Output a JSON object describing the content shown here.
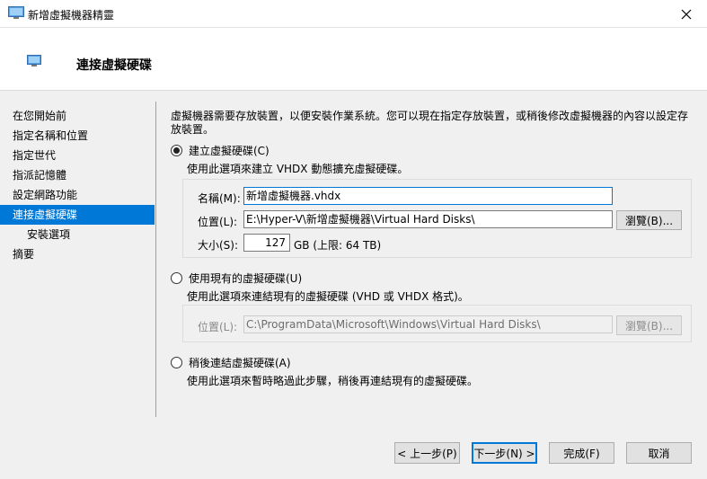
{
  "window": {
    "title": "新增虛擬機器精靈"
  },
  "header": {
    "title": "連接虛擬硬碟"
  },
  "nav": {
    "items": [
      {
        "label": "在您開始前"
      },
      {
        "label": "指定名稱和位置"
      },
      {
        "label": "指定世代"
      },
      {
        "label": "指派記憶體"
      },
      {
        "label": "設定網路功能"
      },
      {
        "label": "連接虛擬硬碟"
      },
      {
        "label": "安裝選項"
      },
      {
        "label": "摘要"
      }
    ],
    "active_index": 5
  },
  "main": {
    "intro_line1": "虛擬機器需要存放裝置，以便安裝作業系統。您可以現在指定存放裝置，或稍後修改虛擬機器的內容以設定存",
    "intro_line2": "放裝置。",
    "create": {
      "label": "建立虛擬硬碟(C)",
      "description": "使用此選項來建立 VHDX 動態擴充虛擬硬碟。",
      "name_label": "名稱(M):",
      "name_value": "新增虛擬機器.vhdx",
      "location_label": "位置(L):",
      "location_value": "E:\\Hyper-V\\新增虛擬機器\\Virtual Hard Disks\\",
      "browse_label": "瀏覽(B)...",
      "size_label": "大小(S):",
      "size_value": "127",
      "size_unit": "GB (上限: 64 TB)"
    },
    "existing": {
      "label": "使用現有的虛擬硬碟(U)",
      "description": "使用此選項來連結現有的虛擬硬碟 (VHD 或 VHDX 格式)。",
      "location_label": "位置(L):",
      "location_value": "C:\\ProgramData\\Microsoft\\Windows\\Virtual Hard Disks\\",
      "browse_label": "瀏覽(B)..."
    },
    "later": {
      "label": "稍後連結虛擬硬碟(A)",
      "description": "使用此選項來暫時略過此步驟，稍後再連結現有的虛擬硬碟。"
    }
  },
  "footer": {
    "prev_label": "< 上一步(P)",
    "next_label": "下一步(N) >",
    "finish_label": "完成(F)",
    "cancel_label": "取消"
  },
  "colors": {
    "accent": "#0078d7"
  }
}
